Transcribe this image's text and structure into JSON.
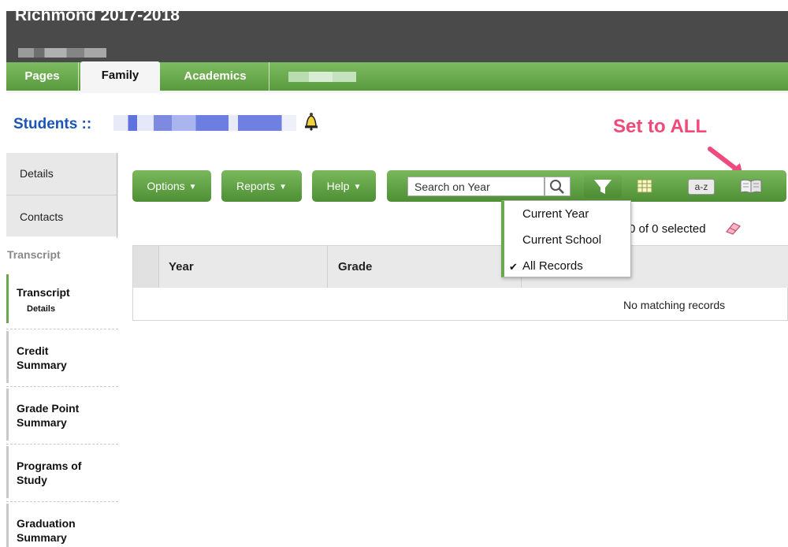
{
  "header": {
    "school_year_title": "Richmond 2017-2018"
  },
  "tabs": [
    {
      "label": "Pages"
    },
    {
      "label": "Family"
    },
    {
      "label": "Academics"
    }
  ],
  "page": {
    "title": "Students ::"
  },
  "annotation": {
    "label": "Set to ALL",
    "color": "#f04a79"
  },
  "sidebar": {
    "top_tabs": [
      {
        "label": "Details"
      },
      {
        "label": "Contacts"
      }
    ],
    "section_label": "Transcript",
    "items": [
      {
        "label": "Transcript",
        "sublabel": "Details",
        "active": true
      },
      {
        "label": "Credit Summary"
      },
      {
        "label": "Grade Point Summary"
      },
      {
        "label": "Programs of Study"
      },
      {
        "label": "Graduation Summary"
      }
    ]
  },
  "toolbar": {
    "options_label": "Options",
    "reports_label": "Reports",
    "help_label": "Help",
    "search_placeholder": "Search on Year",
    "sort_label": "a-z",
    "icons": [
      "search-icon",
      "filter-icon",
      "grid-view-icon",
      "sort-az-icon",
      "book-icon"
    ]
  },
  "filter_menu": {
    "items": [
      {
        "label": "Current Year",
        "checked": false
      },
      {
        "label": "Current School",
        "checked": false
      },
      {
        "label": "All Records",
        "checked": true
      }
    ],
    "check_mark": "✔"
  },
  "selection": {
    "count_text": "0 of 0 selected"
  },
  "table": {
    "columns": [
      "Year",
      "Grade"
    ],
    "empty_message": "No matching records"
  },
  "colors": {
    "accent_green": "#5a9a3f",
    "link_blue": "#1c55b8",
    "header_gray": "#4a4a4a"
  }
}
